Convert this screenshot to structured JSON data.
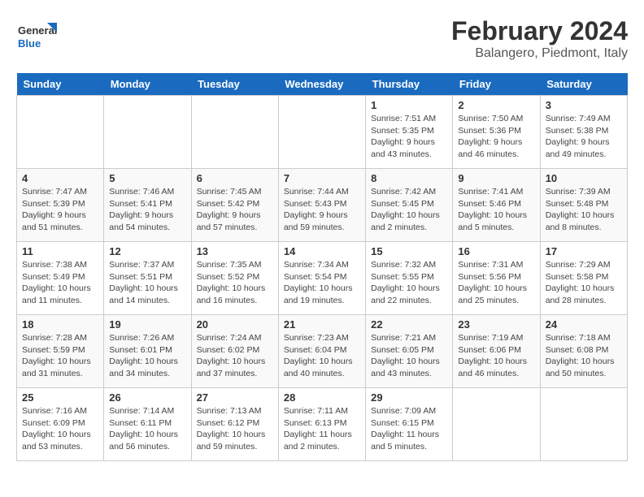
{
  "logo": {
    "line1": "General",
    "line2": "Blue"
  },
  "title": "February 2024",
  "subtitle": "Balangero, Piedmont, Italy",
  "weekdays": [
    "Sunday",
    "Monday",
    "Tuesday",
    "Wednesday",
    "Thursday",
    "Friday",
    "Saturday"
  ],
  "weeks": [
    [
      {
        "day": "",
        "info": ""
      },
      {
        "day": "",
        "info": ""
      },
      {
        "day": "",
        "info": ""
      },
      {
        "day": "",
        "info": ""
      },
      {
        "day": "1",
        "info": "Sunrise: 7:51 AM\nSunset: 5:35 PM\nDaylight: 9 hours\nand 43 minutes."
      },
      {
        "day": "2",
        "info": "Sunrise: 7:50 AM\nSunset: 5:36 PM\nDaylight: 9 hours\nand 46 minutes."
      },
      {
        "day": "3",
        "info": "Sunrise: 7:49 AM\nSunset: 5:38 PM\nDaylight: 9 hours\nand 49 minutes."
      }
    ],
    [
      {
        "day": "4",
        "info": "Sunrise: 7:47 AM\nSunset: 5:39 PM\nDaylight: 9 hours\nand 51 minutes."
      },
      {
        "day": "5",
        "info": "Sunrise: 7:46 AM\nSunset: 5:41 PM\nDaylight: 9 hours\nand 54 minutes."
      },
      {
        "day": "6",
        "info": "Sunrise: 7:45 AM\nSunset: 5:42 PM\nDaylight: 9 hours\nand 57 minutes."
      },
      {
        "day": "7",
        "info": "Sunrise: 7:44 AM\nSunset: 5:43 PM\nDaylight: 9 hours\nand 59 minutes."
      },
      {
        "day": "8",
        "info": "Sunrise: 7:42 AM\nSunset: 5:45 PM\nDaylight: 10 hours\nand 2 minutes."
      },
      {
        "day": "9",
        "info": "Sunrise: 7:41 AM\nSunset: 5:46 PM\nDaylight: 10 hours\nand 5 minutes."
      },
      {
        "day": "10",
        "info": "Sunrise: 7:39 AM\nSunset: 5:48 PM\nDaylight: 10 hours\nand 8 minutes."
      }
    ],
    [
      {
        "day": "11",
        "info": "Sunrise: 7:38 AM\nSunset: 5:49 PM\nDaylight: 10 hours\nand 11 minutes."
      },
      {
        "day": "12",
        "info": "Sunrise: 7:37 AM\nSunset: 5:51 PM\nDaylight: 10 hours\nand 14 minutes."
      },
      {
        "day": "13",
        "info": "Sunrise: 7:35 AM\nSunset: 5:52 PM\nDaylight: 10 hours\nand 16 minutes."
      },
      {
        "day": "14",
        "info": "Sunrise: 7:34 AM\nSunset: 5:54 PM\nDaylight: 10 hours\nand 19 minutes."
      },
      {
        "day": "15",
        "info": "Sunrise: 7:32 AM\nSunset: 5:55 PM\nDaylight: 10 hours\nand 22 minutes."
      },
      {
        "day": "16",
        "info": "Sunrise: 7:31 AM\nSunset: 5:56 PM\nDaylight: 10 hours\nand 25 minutes."
      },
      {
        "day": "17",
        "info": "Sunrise: 7:29 AM\nSunset: 5:58 PM\nDaylight: 10 hours\nand 28 minutes."
      }
    ],
    [
      {
        "day": "18",
        "info": "Sunrise: 7:28 AM\nSunset: 5:59 PM\nDaylight: 10 hours\nand 31 minutes."
      },
      {
        "day": "19",
        "info": "Sunrise: 7:26 AM\nSunset: 6:01 PM\nDaylight: 10 hours\nand 34 minutes."
      },
      {
        "day": "20",
        "info": "Sunrise: 7:24 AM\nSunset: 6:02 PM\nDaylight: 10 hours\nand 37 minutes."
      },
      {
        "day": "21",
        "info": "Sunrise: 7:23 AM\nSunset: 6:04 PM\nDaylight: 10 hours\nand 40 minutes."
      },
      {
        "day": "22",
        "info": "Sunrise: 7:21 AM\nSunset: 6:05 PM\nDaylight: 10 hours\nand 43 minutes."
      },
      {
        "day": "23",
        "info": "Sunrise: 7:19 AM\nSunset: 6:06 PM\nDaylight: 10 hours\nand 46 minutes."
      },
      {
        "day": "24",
        "info": "Sunrise: 7:18 AM\nSunset: 6:08 PM\nDaylight: 10 hours\nand 50 minutes."
      }
    ],
    [
      {
        "day": "25",
        "info": "Sunrise: 7:16 AM\nSunset: 6:09 PM\nDaylight: 10 hours\nand 53 minutes."
      },
      {
        "day": "26",
        "info": "Sunrise: 7:14 AM\nSunset: 6:11 PM\nDaylight: 10 hours\nand 56 minutes."
      },
      {
        "day": "27",
        "info": "Sunrise: 7:13 AM\nSunset: 6:12 PM\nDaylight: 10 hours\nand 59 minutes."
      },
      {
        "day": "28",
        "info": "Sunrise: 7:11 AM\nSunset: 6:13 PM\nDaylight: 11 hours\nand 2 minutes."
      },
      {
        "day": "29",
        "info": "Sunrise: 7:09 AM\nSunset: 6:15 PM\nDaylight: 11 hours\nand 5 minutes."
      },
      {
        "day": "",
        "info": ""
      },
      {
        "day": "",
        "info": ""
      }
    ]
  ]
}
